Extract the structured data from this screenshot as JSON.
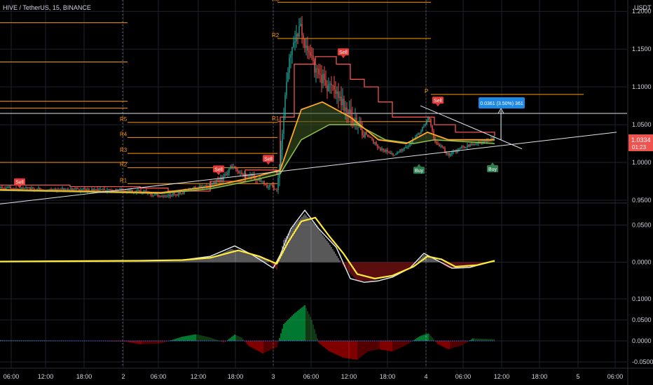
{
  "header": {
    "title": "HIVE / TetherUS, 15, BINANCE",
    "currency": "USDT"
  },
  "price_badge": {
    "price": "1.0334",
    "countdown": "01:23"
  },
  "measure_label": "0.0361 (3.50%) 361",
  "colors": {
    "background": "#000000",
    "grid": "#1e222d",
    "up": "#26a69a",
    "down": "#ef5350",
    "pivot": "#ff9800",
    "yellow": "#ffeb3b",
    "white": "#e0e3eb",
    "trail": "#ef5350",
    "hist_up": "#00c853",
    "hist_down": "#d50000",
    "buy": "#2e7d4f",
    "sell": "#e53935",
    "badge": "#ef5350",
    "measure": "#1e88e5"
  },
  "chart_data": {
    "type": "candlestick",
    "panes": [
      {
        "name": "price",
        "ylim": [
          0.95,
          1.215
        ],
        "yticks": [
          "1.2000",
          "1.1500",
          "1.1000",
          "1.0500",
          "1.0000",
          "0.9500"
        ],
        "ytick_values": [
          1.2,
          1.15,
          1.1,
          1.05,
          1.0,
          0.95
        ],
        "close_path": [
          [
            0,
            0.966
          ],
          [
            50,
            0.965
          ],
          [
            100,
            0.964
          ],
          [
            150,
            0.963
          ],
          [
            200,
            0.962
          ],
          [
            230,
            0.955
          ],
          [
            255,
            0.958
          ],
          [
            270,
            0.965
          ],
          [
            300,
            0.97
          ],
          [
            320,
            0.98
          ],
          [
            330,
            0.995
          ],
          [
            340,
            0.985
          ],
          [
            360,
            0.982
          ],
          [
            380,
            0.97
          ],
          [
            395,
            0.965
          ],
          [
            400,
            1.0
          ],
          [
            410,
            1.12
          ],
          [
            420,
            1.16
          ],
          [
            430,
            1.18
          ],
          [
            440,
            1.14
          ],
          [
            460,
            1.11
          ],
          [
            480,
            1.09
          ],
          [
            500,
            1.06
          ],
          [
            520,
            1.04
          ],
          [
            540,
            1.02
          ],
          [
            560,
            1.01
          ],
          [
            580,
            1.02
          ],
          [
            600,
            1.04
          ],
          [
            612,
            1.06
          ],
          [
            620,
            1.03
          ],
          [
            640,
            1.01
          ],
          [
            660,
            1.02
          ],
          [
            680,
            1.025
          ],
          [
            700,
            1.03
          ],
          [
            706,
            1.0334
          ]
        ],
        "ma_orange_path": [
          [
            0,
            0.964
          ],
          [
            230,
            0.96
          ],
          [
            300,
            0.968
          ],
          [
            360,
            0.98
          ],
          [
            400,
            0.99
          ],
          [
            430,
            1.07
          ],
          [
            460,
            1.08
          ],
          [
            500,
            1.06
          ],
          [
            540,
            1.03
          ],
          [
            580,
            1.025
          ],
          [
            610,
            1.04
          ],
          [
            640,
            1.03
          ],
          [
            706,
            1.03
          ]
        ],
        "ma_green_path": [
          [
            0,
            0.963
          ],
          [
            230,
            0.959
          ],
          [
            300,
            0.965
          ],
          [
            360,
            0.976
          ],
          [
            400,
            0.985
          ],
          [
            430,
            1.03
          ],
          [
            470,
            1.05
          ],
          [
            510,
            1.05
          ],
          [
            550,
            1.03
          ],
          [
            590,
            1.025
          ],
          [
            620,
            1.03
          ],
          [
            706,
            1.025
          ]
        ],
        "trail_path": [
          [
            0,
            0.97
          ],
          [
            100,
            0.968
          ],
          [
            200,
            0.966
          ],
          [
            240,
            0.962
          ],
          [
            300,
            0.975
          ],
          [
            350,
            0.99
          ],
          [
            395,
            0.985
          ],
          [
            400,
            1.06
          ],
          [
            420,
            1.13
          ],
          [
            450,
            1.14
          ],
          [
            480,
            1.13
          ],
          [
            500,
            1.11
          ],
          [
            520,
            1.1
          ],
          [
            540,
            1.08
          ],
          [
            560,
            1.06
          ],
          [
            600,
            1.06
          ],
          [
            620,
            1.05
          ],
          [
            650,
            1.04
          ],
          [
            706,
            1.035
          ]
        ],
        "pivots": [
          {
            "label": "R5",
            "value": 1.053
          },
          {
            "label": "R4",
            "value": 1.033
          },
          {
            "label": "R3",
            "value": 1.012
          },
          {
            "label": "R2",
            "value": 0.993
          },
          {
            "label": "R1",
            "value": 0.972
          },
          {
            "label": "R1",
            "value": 1.054
          },
          {
            "label": "R2",
            "value": 1.164
          },
          {
            "label": "R3",
            "value": 1.212
          },
          {
            "label": "P",
            "value": 1.09
          }
        ],
        "hlines": [
          1.185,
          1.133,
          1.081,
          1.072,
          1.0
        ],
        "support_line": [
          [
            0,
            0.945
          ],
          [
            880,
            1.04
          ]
        ],
        "resistance_line": [
          [
            600,
            1.075
          ],
          [
            745,
            1.018
          ]
        ],
        "signals": [
          {
            "label": "Sell",
            "x": 28,
            "y": 0.966
          },
          {
            "label": "Sell",
            "x": 312,
            "y": 0.983
          },
          {
            "label": "Sell",
            "x": 383,
            "y": 0.997
          },
          {
            "label": "Sell",
            "x": 490,
            "y": 1.138
          },
          {
            "label": "Sell",
            "x": 625,
            "y": 1.074
          },
          {
            "label": "Buy",
            "x": 598,
            "y": 0.998
          },
          {
            "label": "Buy",
            "x": 703,
            "y": 1.0
          }
        ]
      },
      {
        "name": "oscillator",
        "ylim": [
          -0.038,
          0.075
        ],
        "yticks": [
          "0.0500",
          "0.0000"
        ],
        "ytick_values": [
          0.05,
          0.0
        ],
        "hist": [
          [
            0,
            0.001
          ],
          [
            100,
            0.001
          ],
          [
            200,
            0.001
          ],
          [
            250,
            0.002
          ],
          [
            300,
            0.005
          ],
          [
            330,
            0.018
          ],
          [
            350,
            0.012
          ],
          [
            380,
            0.005
          ],
          [
            395,
            -0.01
          ],
          [
            405,
            0.03
          ],
          [
            420,
            0.05
          ],
          [
            435,
            0.065
          ],
          [
            450,
            0.05
          ],
          [
            470,
            0.025
          ],
          [
            490,
            -0.005
          ],
          [
            510,
            -0.025
          ],
          [
            530,
            -0.025
          ],
          [
            550,
            -0.02
          ],
          [
            570,
            -0.015
          ],
          [
            590,
            -0.005
          ],
          [
            605,
            0.01
          ],
          [
            620,
            0.005
          ],
          [
            640,
            -0.008
          ],
          [
            660,
            -0.008
          ],
          [
            680,
            -0.004
          ],
          [
            706,
            0.002
          ]
        ],
        "white_line": [
          [
            0,
            0.001
          ],
          [
            200,
            0.002
          ],
          [
            260,
            0.003
          ],
          [
            300,
            0.008
          ],
          [
            335,
            0.022
          ],
          [
            360,
            0.01
          ],
          [
            390,
            -0.008
          ],
          [
            400,
            0.01
          ],
          [
            415,
            0.045
          ],
          [
            435,
            0.07
          ],
          [
            455,
            0.045
          ],
          [
            480,
            0.02
          ],
          [
            500,
            -0.022
          ],
          [
            520,
            -0.027
          ],
          [
            540,
            -0.025
          ],
          [
            560,
            -0.02
          ],
          [
            585,
            -0.008
          ],
          [
            605,
            0.012
          ],
          [
            625,
            0.002
          ],
          [
            645,
            -0.008
          ],
          [
            670,
            -0.007
          ],
          [
            706,
            0.002
          ]
        ],
        "yellow_line": [
          [
            0,
            0.001
          ],
          [
            200,
            0.002
          ],
          [
            260,
            0.003
          ],
          [
            300,
            0.006
          ],
          [
            340,
            0.016
          ],
          [
            370,
            0.008
          ],
          [
            395,
            -0.002
          ],
          [
            410,
            0.025
          ],
          [
            430,
            0.055
          ],
          [
            450,
            0.06
          ],
          [
            470,
            0.035
          ],
          [
            490,
            0.012
          ],
          [
            510,
            -0.016
          ],
          [
            535,
            -0.022
          ],
          [
            560,
            -0.018
          ],
          [
            590,
            -0.006
          ],
          [
            610,
            0.008
          ],
          [
            630,
            0.004
          ],
          [
            650,
            -0.006
          ],
          [
            680,
            -0.004
          ],
          [
            706,
            0.002
          ]
        ]
      },
      {
        "name": "momentum",
        "ylim": [
          -0.055,
          0.12
        ],
        "yticks": [
          "0.1000",
          "0.0500",
          "0.0000",
          "-0.0500"
        ],
        "ytick_values": [
          0.1,
          0.05,
          0.0,
          -0.05
        ],
        "hist": [
          [
            0,
            0.002
          ],
          [
            100,
            0.001
          ],
          [
            180,
            -0.002
          ],
          [
            200,
            -0.008
          ],
          [
            230,
            -0.006
          ],
          [
            260,
            0.01
          ],
          [
            280,
            0.016
          ],
          [
            300,
            0.008
          ],
          [
            320,
            -0.004
          ],
          [
            335,
            0.015
          ],
          [
            345,
            0.008
          ],
          [
            355,
            -0.012
          ],
          [
            375,
            -0.03
          ],
          [
            395,
            -0.015
          ],
          [
            405,
            0.04
          ],
          [
            420,
            0.065
          ],
          [
            435,
            0.085
          ],
          [
            445,
            0.05
          ],
          [
            455,
            -0.005
          ],
          [
            470,
            -0.025
          ],
          [
            490,
            -0.04
          ],
          [
            510,
            -0.045
          ],
          [
            525,
            -0.025
          ],
          [
            540,
            -0.02
          ],
          [
            560,
            -0.025
          ],
          [
            580,
            -0.01
          ],
          [
            600,
            0.012
          ],
          [
            612,
            0.018
          ],
          [
            625,
            -0.008
          ],
          [
            640,
            -0.02
          ],
          [
            660,
            -0.01
          ],
          [
            675,
            0.006
          ],
          [
            690,
            0.005
          ],
          [
            706,
            0.004
          ]
        ]
      }
    ],
    "xticks": [
      {
        "label": "06:00",
        "x": 16
      },
      {
        "label": "12:00",
        "x": 65
      },
      {
        "label": "18:00",
        "x": 120
      },
      {
        "label": "2",
        "x": 176
      },
      {
        "label": "06:00",
        "x": 226
      },
      {
        "label": "12:00",
        "x": 283
      },
      {
        "label": "18:00",
        "x": 336
      },
      {
        "label": "3",
        "x": 390
      },
      {
        "label": "06:00",
        "x": 444
      },
      {
        "label": "12:00",
        "x": 498
      },
      {
        "label": "18:00",
        "x": 553
      },
      {
        "label": "4",
        "x": 608
      },
      {
        "label": "06:00",
        "x": 661
      },
      {
        "label": "12:00",
        "x": 716
      },
      {
        "label": "18:00",
        "x": 770
      },
      {
        "label": "5",
        "x": 825
      },
      {
        "label": "06:00",
        "x": 878
      }
    ]
  }
}
